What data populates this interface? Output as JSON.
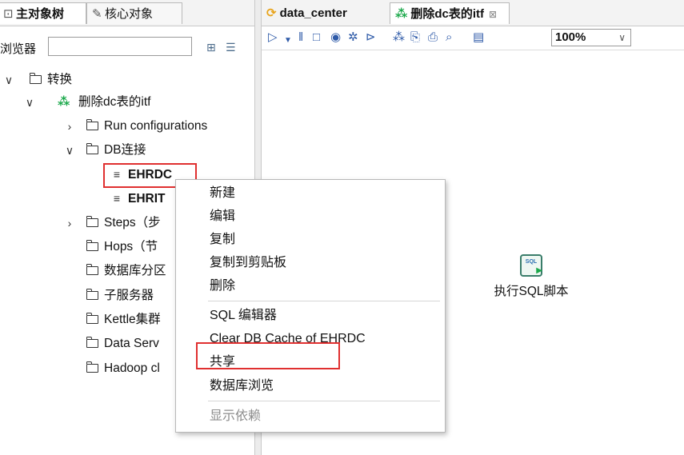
{
  "left_tabs": {
    "main": "主对象树",
    "core": "核心对象"
  },
  "browser": {
    "label": "浏览器",
    "search_value": ""
  },
  "tree": {
    "root": "转换",
    "transform": "删除dc表的itf",
    "run_configs": "Run configurations",
    "db_connections": "DB连接",
    "db1": "EHRDC",
    "db2": "EHRIT",
    "steps": "Steps（步",
    "hops": "Hops（节",
    "partition": "数据库分区",
    "slave": "子服务器",
    "cluster": "Kettle集群",
    "data_service": "Data Serv",
    "hadoop": "Hadoop cl"
  },
  "right_tabs": {
    "data_center": "data_center",
    "itf": "删除dc表的itf"
  },
  "toolbar": {
    "zoom": "100%"
  },
  "canvas": {
    "step_label": "执行SQL脚本",
    "step_icon_text": "SQL"
  },
  "context_menu": {
    "new": "新建",
    "edit": "编辑",
    "copy": "复制",
    "copy_clipboard": "复制到剪贴板",
    "delete": "删除",
    "sql_editor": "SQL 编辑器",
    "clear_cache": "Clear DB Cache of EHRDC",
    "share": "共享",
    "explore": "数据库浏览",
    "show_deps": "显示依赖"
  },
  "colors": {
    "highlight_red": "#e03030",
    "transform_green": "#1aa84a",
    "toolbar_blue": "#2e5aa8"
  }
}
